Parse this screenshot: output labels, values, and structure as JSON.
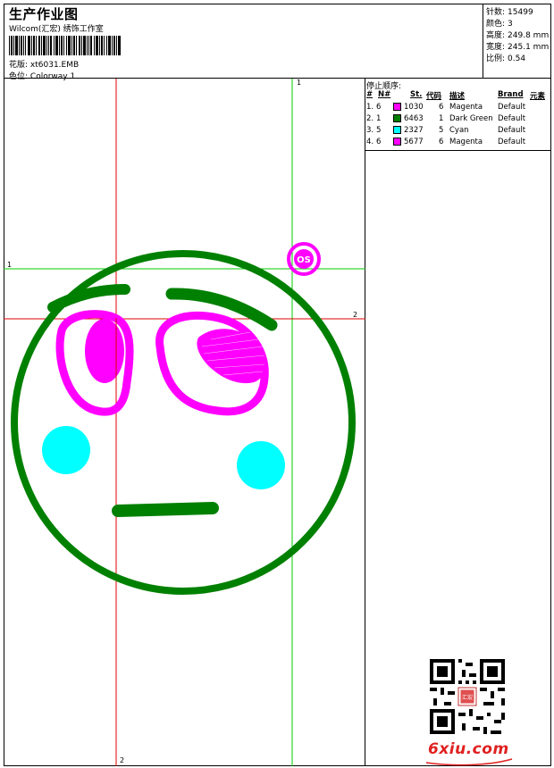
{
  "header": {
    "title": "生产作业图",
    "subtitle": "Wilcom(汇宏) 绣饰工作室",
    "design_label": "花版:",
    "design_value": "xt6031.EMB",
    "colorway_label": "色位:",
    "colorway_value": "Colorway 1"
  },
  "stats": {
    "stitches_label": "针数:",
    "stitches_value": "15499",
    "colors_label": "颜色:",
    "colors_value": "3",
    "height_label": "高度:",
    "height_value": "249.8 mm",
    "width_label": "宽度:",
    "width_value": "245.1 mm",
    "scale_label": "比例:",
    "scale_value": "0.54"
  },
  "stop_sequence": {
    "title": "停止顺序:",
    "columns": [
      "#",
      "N#",
      "St.",
      "代码",
      "描述",
      "Brand",
      "元素"
    ],
    "rows": [
      {
        "index": "1.",
        "needle": "6",
        "color": "#ff00ff",
        "stitches": "1030",
        "code": "6",
        "description": "Magenta",
        "brand": "Default"
      },
      {
        "index": "2.",
        "needle": "1",
        "color": "#008000",
        "stitches": "6463",
        "code": "1",
        "description": "Dark Green",
        "brand": "Default"
      },
      {
        "index": "3.",
        "needle": "5",
        "color": "#00ffff",
        "stitches": "2327",
        "code": "5",
        "description": "Cyan",
        "brand": "Default"
      },
      {
        "index": "4.",
        "needle": "6",
        "color": "#ff00ff",
        "stitches": "5677",
        "code": "6",
        "description": "Magenta",
        "brand": "Default"
      }
    ]
  },
  "guides": {
    "vertical_top_label": "1",
    "vertical_bottom_label": "2",
    "horizontal_left_label": "1",
    "horizontal_right_label": "2"
  },
  "design_colors": {
    "magenta": "#ff00ff",
    "green": "#008000",
    "cyan": "#00ffff",
    "guide_red": "#e00000",
    "guide_green": "#00cc00"
  },
  "design_badge_text": "OS",
  "watermark": "6xiu.com",
  "qr_stamp_text": "汇宏"
}
